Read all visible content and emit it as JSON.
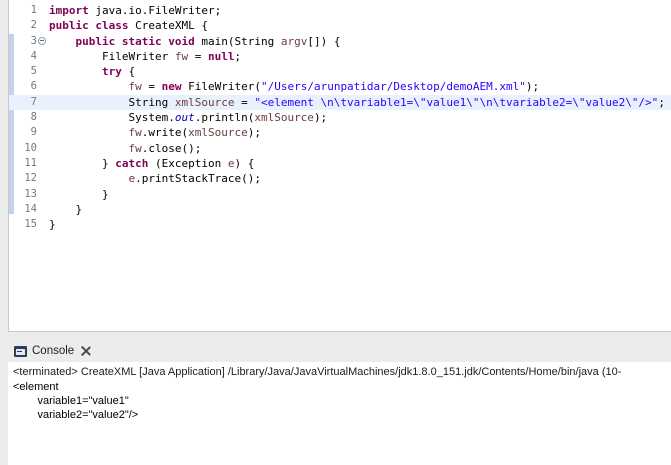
{
  "editor": {
    "lines": [
      {
        "n": "1",
        "parts": [
          {
            "c": "kw",
            "t": "import"
          },
          {
            "c": "",
            "t": " java.io.FileWriter;"
          }
        ]
      },
      {
        "n": "2",
        "parts": [
          {
            "c": "kw",
            "t": "public"
          },
          {
            "c": "",
            "t": " "
          },
          {
            "c": "kw",
            "t": "class"
          },
          {
            "c": "",
            "t": " CreateXML {"
          }
        ]
      },
      {
        "n": "3",
        "fold": true,
        "parts": [
          {
            "c": "",
            "t": "    "
          },
          {
            "c": "kw",
            "t": "public"
          },
          {
            "c": "",
            "t": " "
          },
          {
            "c": "kw",
            "t": "static"
          },
          {
            "c": "",
            "t": " "
          },
          {
            "c": "kw",
            "t": "void"
          },
          {
            "c": "",
            "t": " main(String "
          },
          {
            "c": "var",
            "t": "argv"
          },
          {
            "c": "",
            "t": "[]) {"
          }
        ]
      },
      {
        "n": "4",
        "parts": [
          {
            "c": "",
            "t": "        FileWriter "
          },
          {
            "c": "var",
            "t": "fw"
          },
          {
            "c": "",
            "t": " = "
          },
          {
            "c": "kw",
            "t": "null"
          },
          {
            "c": "",
            "t": ";"
          }
        ]
      },
      {
        "n": "5",
        "parts": [
          {
            "c": "",
            "t": "        "
          },
          {
            "c": "kw",
            "t": "try"
          },
          {
            "c": "",
            "t": " {"
          }
        ]
      },
      {
        "n": "6",
        "parts": [
          {
            "c": "",
            "t": "            "
          },
          {
            "c": "var",
            "t": "fw"
          },
          {
            "c": "",
            "t": " = "
          },
          {
            "c": "kw",
            "t": "new"
          },
          {
            "c": "",
            "t": " FileWriter("
          },
          {
            "c": "str",
            "t": "\"/Users/arunpatidar/Desktop/demoAEM.xml\""
          },
          {
            "c": "",
            "t": ");"
          }
        ]
      },
      {
        "n": "7",
        "current": true,
        "parts": [
          {
            "c": "",
            "t": "            String "
          },
          {
            "c": "var",
            "t": "xmlSource"
          },
          {
            "c": "",
            "t": " = "
          },
          {
            "c": "str",
            "t": "\"<element \\n\\tvariable1=\\\"value1\\\"\\n\\tvariable2=\\\"value2\\\"/>\""
          },
          {
            "c": "",
            "t": ";"
          }
        ]
      },
      {
        "n": "8",
        "parts": [
          {
            "c": "",
            "t": "            System."
          },
          {
            "c": "fld",
            "t": "out"
          },
          {
            "c": "",
            "t": ".println("
          },
          {
            "c": "var",
            "t": "xmlSource"
          },
          {
            "c": "",
            "t": ");"
          }
        ]
      },
      {
        "n": "9",
        "parts": [
          {
            "c": "",
            "t": "            "
          },
          {
            "c": "var",
            "t": "fw"
          },
          {
            "c": "",
            "t": ".write("
          },
          {
            "c": "var",
            "t": "xmlSource"
          },
          {
            "c": "",
            "t": ");"
          }
        ]
      },
      {
        "n": "10",
        "parts": [
          {
            "c": "",
            "t": "            "
          },
          {
            "c": "var",
            "t": "fw"
          },
          {
            "c": "",
            "t": ".close();"
          }
        ]
      },
      {
        "n": "11",
        "parts": [
          {
            "c": "",
            "t": "        } "
          },
          {
            "c": "kw",
            "t": "catch"
          },
          {
            "c": "",
            "t": " (Exception "
          },
          {
            "c": "var",
            "t": "e"
          },
          {
            "c": "",
            "t": ") {"
          }
        ]
      },
      {
        "n": "12",
        "parts": [
          {
            "c": "",
            "t": "            "
          },
          {
            "c": "var",
            "t": "e"
          },
          {
            "c": "",
            "t": ".printStackTrace();"
          }
        ]
      },
      {
        "n": "13",
        "parts": [
          {
            "c": "",
            "t": "        }"
          }
        ]
      },
      {
        "n": "14",
        "parts": [
          {
            "c": "",
            "t": "    }"
          }
        ]
      },
      {
        "n": "15",
        "parts": [
          {
            "c": "",
            "t": "}"
          }
        ]
      }
    ]
  },
  "console": {
    "tab_label": "Console",
    "status": "<terminated> CreateXML [Java Application] /Library/Java/JavaVirtualMachines/jdk1.8.0_151.jdk/Contents/Home/bin/java (10-",
    "output": [
      "<element ",
      "        variable1=\"value1\"",
      "        variable2=\"value2\"/>"
    ]
  },
  "colors": {
    "keyword": "#7f0055",
    "string": "#2a00ff",
    "local_variable": "#6a3e3e",
    "static_field": "#0000c0",
    "current_line": "#e8f2fe"
  },
  "icons": {
    "console": "console-icon",
    "close": "close-icon",
    "fold": "fold-collapse-icon"
  }
}
